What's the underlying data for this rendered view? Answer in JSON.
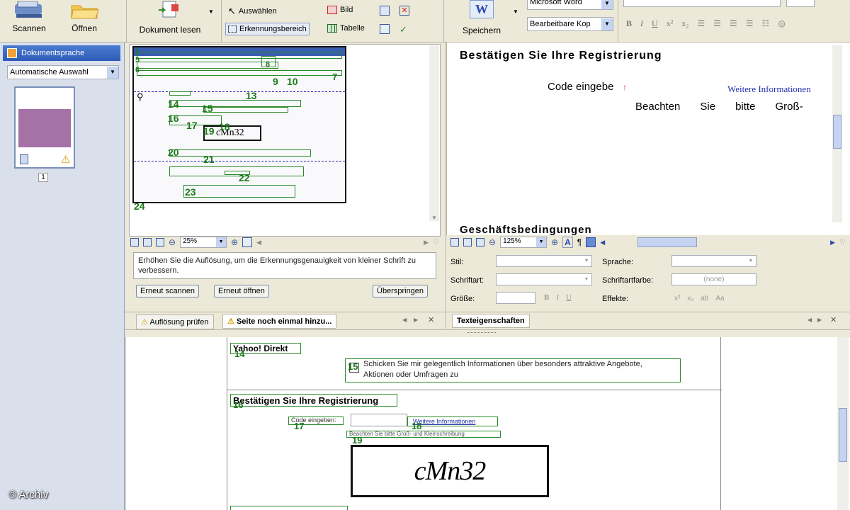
{
  "toolbar": {
    "scan": "Scannen",
    "open": "Öffnen",
    "read": "Dokument lesen",
    "select": "Auswählen",
    "region": "Erkennungsbereich",
    "picture": "Bild",
    "table": "Tabelle",
    "save": "Speichern",
    "word": "Microsoft Word",
    "editable": "Bearbeitbare Kop",
    "format_btns": [
      "B",
      "I",
      "U",
      "x²",
      "x₂"
    ]
  },
  "sidebar": {
    "lang_header": "Dokumentsprache",
    "lang_value": "Automatische Auswahl",
    "page_num": "1"
  },
  "preview": {
    "zoom": "25%",
    "tip": "Erhöhen Sie die Auflösung, um die Erkennungsgenauigkeit von kleiner Schrift zu verbessern.",
    "rescan": "Erneut scannen",
    "reopen": "Erneut öffnen",
    "skip": "Überspringen",
    "region_numbers": [
      "1",
      "5",
      "6",
      "7",
      "8",
      "9",
      "10",
      "13",
      "14",
      "15",
      "16",
      "17",
      "19",
      "18",
      "20",
      "21",
      "22",
      "23",
      "24"
    ]
  },
  "tabs_left": {
    "check": "Auflösung prüfen",
    "add": "Seite noch einmal hinzu..."
  },
  "text_view": {
    "heading1": "Bestätigen Sie Ihre Registrierung",
    "code": "Code eingebe",
    "more": "Weitere Informationen",
    "note_words": [
      "Beachten",
      "Sie",
      "bitte",
      "Groß-"
    ],
    "heading2": "Geschäftsbedingungen",
    "zoom": "125%"
  },
  "props": {
    "style": "Stil:",
    "font": "Schriftart:",
    "size": "Größe:",
    "language": "Sprache:",
    "fontcolor": "Schriftartfarbe:",
    "fontcolor_val": "(none)",
    "effects": "Effekte:",
    "effect_btns": [
      "x²",
      "x₂",
      "ab",
      "Aa"
    ],
    "tab": "Texteigenschaften"
  },
  "bottom": {
    "yahoo": "Yahoo! Direkt",
    "yahoo_num": "14",
    "check_text1": "Schicken Sie mir gelegentlich Informationen über besonders attraktive Angebote,",
    "check_text2": "Aktionen oder Umfragen zu",
    "check_num": "15",
    "reg": "Bestätigen Sie Ihre Registrierung",
    "reg_num": "16",
    "code_label": "Code eingeben:",
    "code_num": "17",
    "more": "Weitere Informationen",
    "more_num": "18",
    "note": "Beachten Sie bitte Groß- und Kleinschreibung",
    "captcha_num": "19",
    "captcha": "cMn32"
  },
  "watermark": "© Archiv"
}
